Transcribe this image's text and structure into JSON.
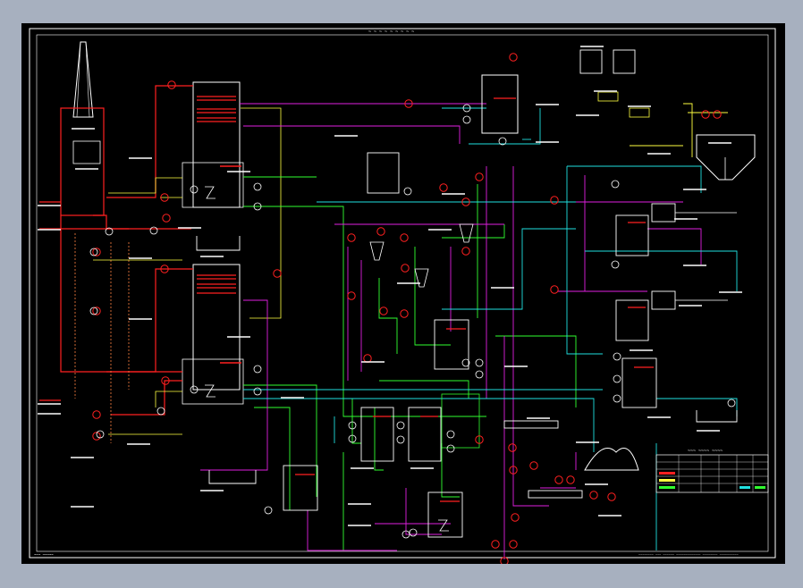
{
  "drawing": {
    "background": "#000000",
    "window_background": "#a7b0bf",
    "title_strip": "~ ~ ~ ~ ~ ~ ~ ~ ~",
    "labels": {
      "table_title": "~~~ ~~~~ ~~~~",
      "corner_text": "~~~  ~~~~~",
      "bottom_note": "~~~~~~~~ ~~~ ~~~~~~ ~~~~~~~~~~~~~ ~~~~~~~~ ~~~~~~~~~~"
    },
    "colors": {
      "red": "#ff2020",
      "yellow": "#ffff40",
      "green": "#30ff30",
      "magenta": "#e020e0",
      "cyan": "#20e0e0",
      "white": "#ffffff",
      "orange": "#ff8040",
      "border": "#ffffff"
    }
  }
}
